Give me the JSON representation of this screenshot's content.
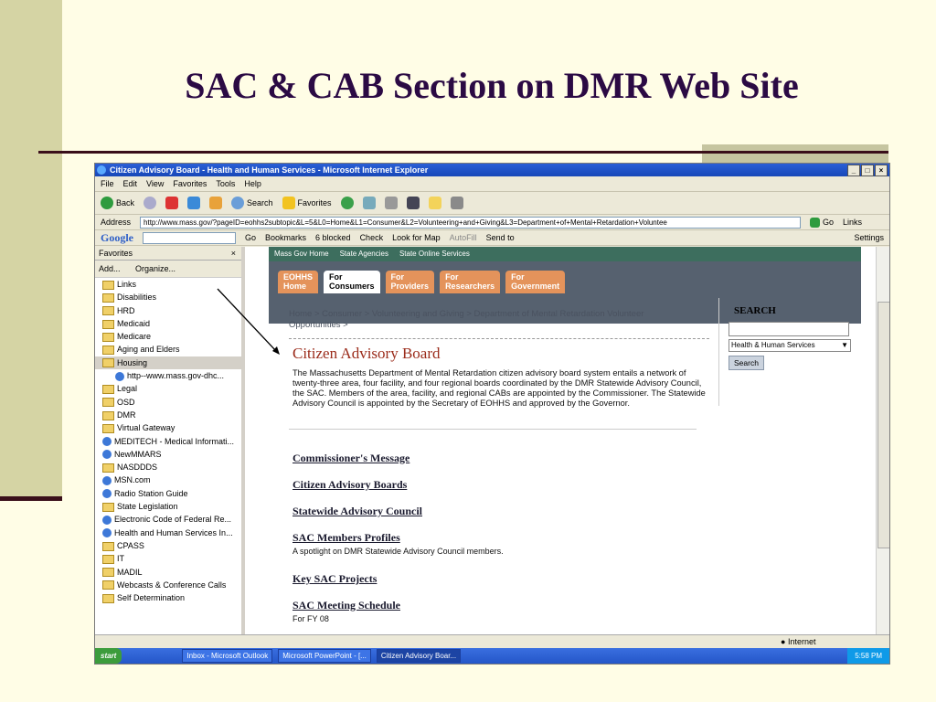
{
  "slide": {
    "title": "SAC & CAB Section on DMR Web Site"
  },
  "window": {
    "title": "Citizen Advisory Board - Health and Human Services - Microsoft Internet Explorer",
    "controls": [
      "_",
      "□",
      "×"
    ]
  },
  "menu": [
    "File",
    "Edit",
    "View",
    "Favorites",
    "Tools",
    "Help"
  ],
  "toolbar": {
    "back": "Back",
    "search": "Search",
    "favorites": "Favorites"
  },
  "address": {
    "label": "Address",
    "url": "http://www.mass.gov/?pageID=eohhs2subtopic&L=5&L0=Home&L1=Consumer&L2=Volunteering+and+Giving&L3=Department+of+Mental+Retardation+Voluntee",
    "go": "Go",
    "links": "Links"
  },
  "google_bar": {
    "logo": "Google",
    "go": "Go",
    "bookmarks": "Bookmarks",
    "blocked": "6 blocked",
    "check": "Check",
    "look_for_map": "Look for Map",
    "autofill": "AutoFill",
    "send_to": "Send to",
    "settings": "Settings"
  },
  "favorites_panel": {
    "header": "Favorites",
    "add": "Add...",
    "organize": "Organize...",
    "items": [
      {
        "label": "Links",
        "type": "folder"
      },
      {
        "label": "Disabilities",
        "type": "folder"
      },
      {
        "label": "HRD",
        "type": "folder"
      },
      {
        "label": "Medicaid",
        "type": "folder"
      },
      {
        "label": "Medicare",
        "type": "folder"
      },
      {
        "label": "Aging and Elders",
        "type": "folder"
      },
      {
        "label": "Housing",
        "type": "folder",
        "selected": true
      },
      {
        "label": "http--www.mass.gov-dhc...",
        "type": "page",
        "indent": true
      },
      {
        "label": "Legal",
        "type": "folder"
      },
      {
        "label": "OSD",
        "type": "folder"
      },
      {
        "label": "DMR",
        "type": "folder"
      },
      {
        "label": "Virtual Gateway",
        "type": "folder"
      },
      {
        "label": "MEDITECH - Medical Informati...",
        "type": "page"
      },
      {
        "label": "NewMMARS",
        "type": "page"
      },
      {
        "label": "NASDDDS",
        "type": "folder"
      },
      {
        "label": "MSN.com",
        "type": "page"
      },
      {
        "label": "Radio Station Guide",
        "type": "page"
      },
      {
        "label": "State Legislation",
        "type": "folder"
      },
      {
        "label": "Electronic Code of Federal Re...",
        "type": "page"
      },
      {
        "label": "Health and Human Services In...",
        "type": "page"
      },
      {
        "label": "CPASS",
        "type": "folder"
      },
      {
        "label": "IT",
        "type": "folder"
      },
      {
        "label": "MADIL",
        "type": "folder"
      },
      {
        "label": "Webcasts & Conference Calls",
        "type": "folder"
      },
      {
        "label": "Self Determination",
        "type": "folder"
      }
    ]
  },
  "site": {
    "top_links": [
      "Mass Gov Home",
      "State Agencies",
      "State Online Services"
    ],
    "tabs": [
      {
        "line1": "EOHHS",
        "line2": "Home"
      },
      {
        "line1": "For",
        "line2": "Consumers",
        "active": true
      },
      {
        "line1": "For",
        "line2": "Providers"
      },
      {
        "line1": "For",
        "line2": "Researchers"
      },
      {
        "line1": "For",
        "line2": "Government"
      }
    ],
    "breadcrumb": "Home > Consumer > Volunteering and Giving > Department of Mental Retardation Volunteer Opportunities >",
    "heading": "Citizen Advisory Board",
    "intro": "The Massachusetts Department of Mental Retardation citizen advisory board system entails a network of twenty-three area, four facility, and four regional boards coordinated by the DMR Statewide Advisory Council, the SAC. Members of the area, facility, and regional CABs are appointed by the Commissioner. The Statewide Advisory Council is appointed by the Secretary of EOHHS and approved by the Governor.",
    "links": [
      {
        "label": "Commissioner's Message",
        "desc": ""
      },
      {
        "label": "Citizen Advisory Boards",
        "desc": ""
      },
      {
        "label": "Statewide Advisory Council",
        "desc": ""
      },
      {
        "label": "SAC Members Profiles",
        "desc": "A spotlight on DMR Statewide Advisory Council members."
      },
      {
        "label": "Key SAC Projects",
        "desc": ""
      },
      {
        "label": "SAC Meeting Schedule",
        "desc": "For FY 08"
      }
    ],
    "search": {
      "heading": "SEARCH",
      "select": "Health & Human Services",
      "button": "Search"
    }
  },
  "status_bar": {
    "zone": "Internet"
  },
  "taskbar": {
    "start": "start",
    "tasks": [
      {
        "label": "Inbox - Microsoft Outlook"
      },
      {
        "label": "Microsoft PowerPoint - [..."
      },
      {
        "label": "Citizen Advisory Boar...",
        "active": true
      }
    ],
    "clock": "5:58 PM"
  }
}
